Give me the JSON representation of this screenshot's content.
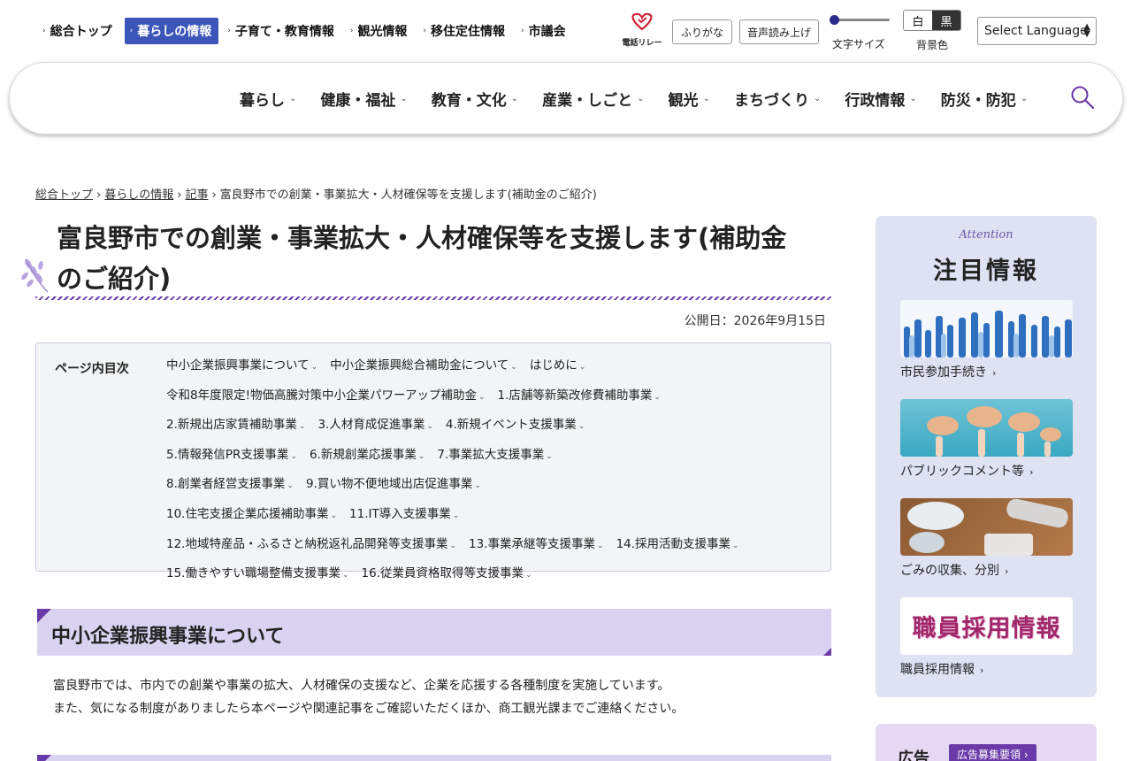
{
  "topnav": [
    {
      "label": "総合トップ",
      "active": false
    },
    {
      "label": "暮らしの情報",
      "active": true
    },
    {
      "label": "子育て・教育情報",
      "active": false
    },
    {
      "label": "観光情報",
      "active": false
    },
    {
      "label": "移住定住情報",
      "active": false
    },
    {
      "label": "市議会",
      "active": false
    }
  ],
  "tools": {
    "furigana": "ふりがな",
    "voice": "音声読み上げ",
    "font_size_label": "文字サイズ",
    "bg_white": "白",
    "bg_black": "黒",
    "bg_label": "背景色",
    "language": "Select Language",
    "relay_label": "電話リレーサービス"
  },
  "mainnav": [
    "暮らし",
    "健康・福祉",
    "教育・文化",
    "産業・しごと",
    "観光",
    "まちづくり",
    "行政情報",
    "防災・防犯"
  ],
  "breadcrumb": {
    "items": [
      "総合トップ",
      "暮らしの情報",
      "記事"
    ],
    "current": "富良野市での創業・事業拡大・人材確保等を支援します(補助金のご紹介)"
  },
  "page": {
    "title": "富良野市での創業・事業拡大・人材確保等を支援します(補助金のご紹介)",
    "published": "公開日：2026年9月15日"
  },
  "toc": {
    "heading": "ページ内目次",
    "items": [
      "中小企業振興事業について",
      "中小企業振興総合補助金について",
      "はじめに",
      "令和8年度限定!物価高騰対策中小企業パワーアップ補助金",
      "1.店舗等新築改修費補助事業",
      "2.新規出店家賃補助事業",
      "3.人材育成促進事業",
      "4.新規イベント支援事業",
      "5.情報発信PR支援事業",
      "6.新規創業応援事業",
      "7.事業拡大支援事業",
      "8.創業者経営支援事業",
      "9.買い物不便地域出店促進事業",
      "10.住宅支援企業応援補助事業",
      "11.IT導入支援事業",
      "12.地域特産品・ふるさと納税返礼品開発等支援事業",
      "13.事業承継等支援事業",
      "14.採用活動支援事業",
      "15.働きやすい職場整備支援事業",
      "16.従業員資格取得等支援事業"
    ]
  },
  "section1": {
    "heading": "中小企業振興事業について",
    "p1": "富良野市では、市内での創業や事業の拡大、人材確保の支援など、企業を応援する各種制度を実施しています。",
    "p2": "また、気になる制度がありましたら本ページや関連記事をご確認いただくほか、商工観光課までご連絡ください。"
  },
  "sidebar": {
    "attention": "Attention",
    "heading": "注目情報",
    "cards": [
      {
        "label": "市民参加手続き"
      },
      {
        "label": "パブリックコメント等"
      },
      {
        "label": "ごみの収集、分別"
      },
      {
        "label": "職員採用情報",
        "banner_text": "職員採用情報"
      }
    ],
    "ad_heading": "広告",
    "ad_button": "広告募集要領"
  },
  "colors": {
    "accent": "#6a3aa8",
    "active_nav": "#3b55b8",
    "section_bg": "#d9d3f1",
    "sidebar_bg": "#dfe2f3"
  }
}
